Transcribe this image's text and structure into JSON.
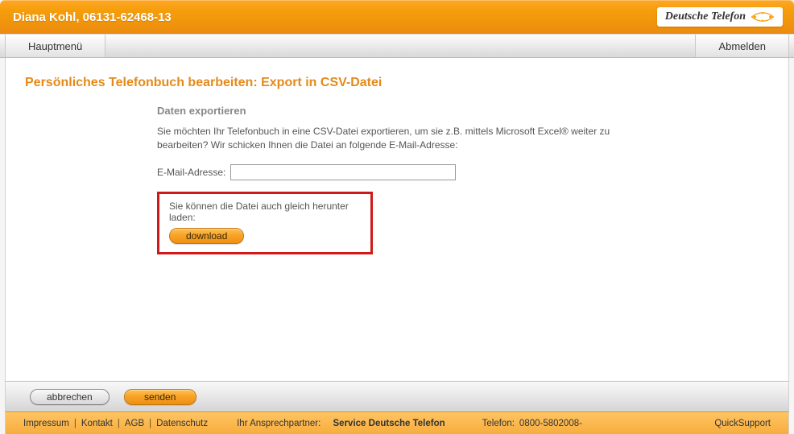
{
  "header": {
    "title": "Diana Kohl, 06131-62468-13",
    "brand_text": "Deutsche Telefon"
  },
  "menubar": {
    "main_menu": "Hauptmenü",
    "logout": "Abmelden"
  },
  "page": {
    "title": "Persönliches Telefonbuch bearbeiten: Export in CSV-Datei",
    "section_heading": "Daten exportieren",
    "description": "Sie möchten Ihr Telefonbuch in eine CSV-Datei exportieren, um sie z.B. mittels Microsoft Excel® weiter zu bearbeiten? Wir schicken Ihnen die Datei an folgende E-Mail-Adresse:",
    "email_label": "E-Mail-Adresse:",
    "email_value": "",
    "download_hint": "Sie können die Datei auch gleich herunter laden:",
    "download_label": "download"
  },
  "actions": {
    "cancel": "abbrechen",
    "send": "senden"
  },
  "footer": {
    "impressum": "Impressum",
    "kontakt": "Kontakt",
    "agb": "AGB",
    "datenschutz": "Datenschutz",
    "contact_label": "Ihr Ansprechpartner:",
    "contact_value": "Service Deutsche Telefon",
    "phone_label": "Telefon:",
    "phone_value": "0800-5802008-",
    "quicksupport": "QuickSupport"
  }
}
